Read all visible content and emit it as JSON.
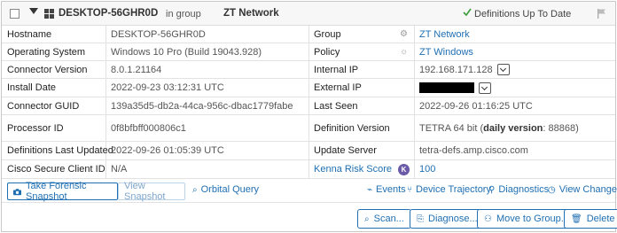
{
  "header": {
    "hostname": "DESKTOP-56GHR0D",
    "in_group": "in group",
    "group": "ZT Network",
    "definitions_status": "Definitions Up To Date"
  },
  "details": {
    "left": [
      {
        "label": "Hostname",
        "value": "DESKTOP-56GHR0D"
      },
      {
        "label": "Operating System",
        "value": "Windows 10 Pro (Build 19043.928)"
      },
      {
        "label": "Connector Version",
        "value": "8.0.1.21164"
      },
      {
        "label": "Install Date",
        "value": "2022-09-23 03:12:31 UTC"
      },
      {
        "label": "Connector GUID",
        "value": "139a35d5-db2a-44ca-956c-dbac1779fabe"
      },
      {
        "label": "Processor ID",
        "value": "0f8bfbff000806c1"
      },
      {
        "label": "Definitions Last Updated",
        "value": "2022-09-26 01:05:39 UTC"
      },
      {
        "label": "Cisco Secure Client ID",
        "value": "N/A"
      }
    ],
    "right": [
      {
        "label": "Group",
        "value": "ZT Network"
      },
      {
        "label": "Policy",
        "value": "ZT Windows"
      },
      {
        "label": "Internal IP",
        "value": "192.168.171.128"
      },
      {
        "label": "External IP",
        "value": ""
      },
      {
        "label": "Last Seen",
        "value": "2022-09-26 01:16:25 UTC"
      },
      {
        "label": "Definition Version",
        "value_prefix": "TETRA 64 bit (",
        "value_bold": "daily version",
        "value_suffix": ": 88868)"
      },
      {
        "label": "Update Server",
        "value": "tetra-defs.amp.cisco.com"
      },
      {
        "label": "Kenna Risk Score",
        "badge": "K",
        "value": "100"
      }
    ]
  },
  "actions": {
    "forensic_snapshot": "Take Forensic Snapshot",
    "view_snapshot": "View Snapshot",
    "orbital_query": "Orbital Query",
    "events": "Events",
    "device_trajectory": "Device Trajectory",
    "diagnostics": "Diagnostics",
    "view_changes": "View Changes"
  },
  "buttons": {
    "scan": "Scan...",
    "diagnose": "Diagnose...",
    "move_to_group": "Move to Group...",
    "delete": "Delete"
  },
  "colors": {
    "link": "#1f6fb2",
    "status_check": "#3a9b3a",
    "kenna_badge": "#6a5aa8"
  }
}
